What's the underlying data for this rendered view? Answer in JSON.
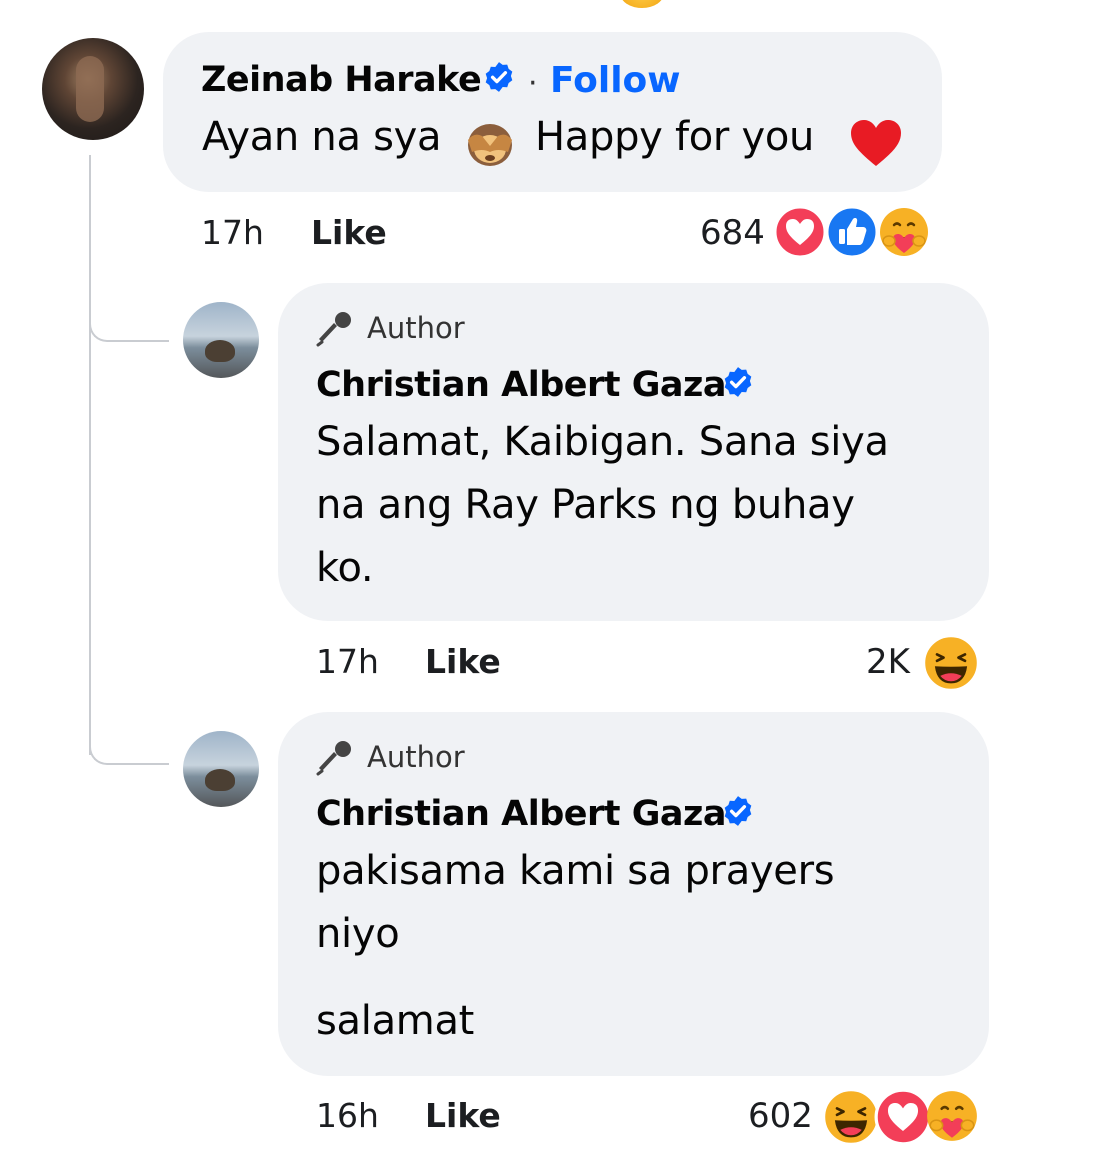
{
  "comments": [
    {
      "author": "Zeinab Harake",
      "verified": true,
      "follow_separator": "·",
      "follow_label": "Follow",
      "text_a": "Ayan na sya",
      "text_b": "Happy for you",
      "emojis": [
        "see-no-evil-monkey",
        "red-heart"
      ],
      "time": "17h",
      "like_label": "Like",
      "reaction_count": "684",
      "reactions": [
        "love",
        "like",
        "care"
      ]
    }
  ],
  "replies": [
    {
      "badge": "Author",
      "badge_icon": "microphone-icon",
      "author": "Christian Albert Gaza",
      "verified": true,
      "lines": [
        "Salamat, Kaibigan. Sana siya",
        "na ang Ray Parks ng buhay",
        "ko."
      ],
      "time": "17h",
      "like_label": "Like",
      "reaction_count": "2K",
      "reactions": [
        "haha"
      ]
    },
    {
      "badge": "Author",
      "badge_icon": "microphone-icon",
      "author": "Christian Albert Gaza",
      "verified": true,
      "lines": [
        "pakisama kami sa prayers",
        "niyo",
        "salamat"
      ],
      "time": "16h",
      "like_label": "Like",
      "reaction_count": "602",
      "reactions": [
        "haha",
        "love",
        "care"
      ]
    }
  ],
  "colors": {
    "bubble": "#f0f2f5",
    "link": "#0866ff",
    "verified": "#0866ff",
    "love": "#f33e58",
    "like": "#1877f2",
    "haha": "#f7b125"
  }
}
